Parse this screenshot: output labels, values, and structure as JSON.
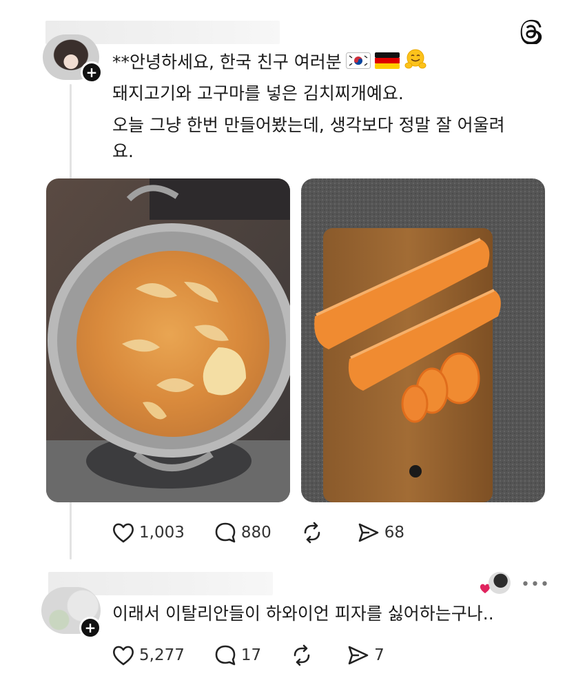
{
  "post": {
    "line1": "**안녕하세요, 한국 친구 여러분",
    "line2": "돼지고기와 고구마를 넣은 김치찌개예요.",
    "line3": "오늘 그냥 한번 만들어봤는데, 생각보다 정말 잘 어울려",
    "line4": "요.",
    "stats": {
      "likes": "1,003",
      "comments": "880",
      "shares": "68"
    },
    "icons": [
      "korea-flag",
      "germany-flag",
      "hugging-face"
    ]
  },
  "reply": {
    "text": "이래서 이탈리안들이 하와이언 피자를 싫어하는구나..",
    "stats": {
      "likes": "5,277",
      "comments": "17",
      "shares": "7"
    }
  },
  "colors": {
    "accent": "#111111",
    "heart_red": "#e0245e",
    "thread_line": "#e3e3e3"
  }
}
